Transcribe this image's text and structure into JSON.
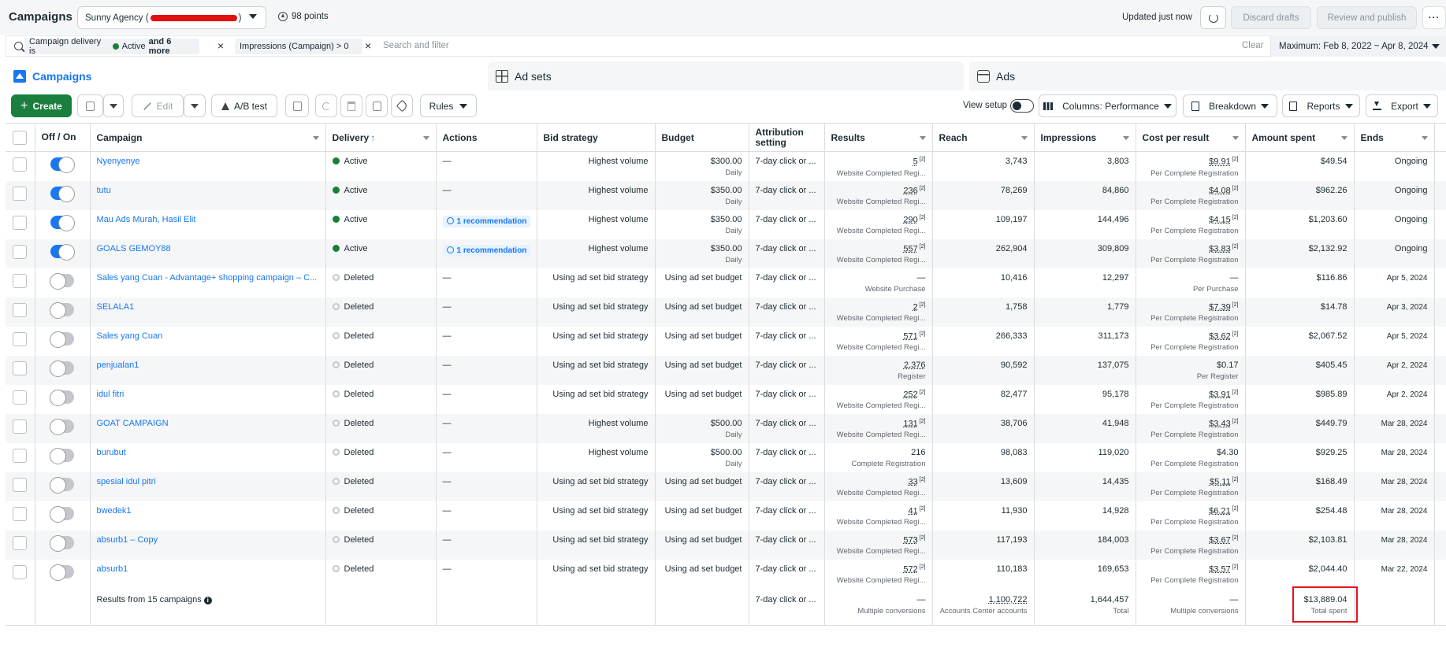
{
  "header": {
    "title": "Campaigns",
    "account_prefix": "Sunny Agency (",
    "account_suffix": ")",
    "points": "98 points",
    "updated": "Updated just now",
    "discard_label": "Discard drafts",
    "publish_label": "Review and publish",
    "more_label": "···"
  },
  "filters": {
    "chip1_text": "Campaign delivery is",
    "chip1_value": "Active",
    "chip1_more": "and 6 more",
    "chip2_text": "Impressions (Campaign) > 0",
    "placeholder": "Search and filter",
    "clear_label": "Clear",
    "date_range": "Maximum: Feb 8, 2022 ~ Apr 8, 2024"
  },
  "tabs": [
    {
      "label": "Campaigns"
    },
    {
      "label": "Ad sets"
    },
    {
      "label": "Ads"
    }
  ],
  "toolbar": {
    "create_label": "Create",
    "edit_label": "Edit",
    "abtest_label": "A/B test",
    "rules_label": "Rules",
    "view_setup_label": "View setup",
    "columns_label": "Columns: Performance",
    "breakdown_label": "Breakdown",
    "reports_label": "Reports",
    "export_label": "Export"
  },
  "columns": {
    "offon": "Off / On",
    "campaign": "Campaign",
    "delivery": "Delivery",
    "actions": "Actions",
    "bid": "Bid strategy",
    "budget": "Budget",
    "attribution": "Attribution setting",
    "results": "Results",
    "reach": "Reach",
    "impressions": "Impressions",
    "cpr": "Cost per result",
    "spent": "Amount spent",
    "ends": "Ends"
  },
  "rows": [
    {
      "on": true,
      "name": "Nyenyenye",
      "delivery": "Active",
      "status": "active",
      "action": "—",
      "bid": "Highest volume",
      "budget": "$300.00",
      "budget_sub": "Daily",
      "attribution": "7-day click or ...",
      "results": "5",
      "results_fn": true,
      "results_sub": "Website Completed Regi...",
      "reach": "3,743",
      "impressions": "3,803",
      "cpr": "$9.91",
      "cpr_fn": true,
      "cpr_sub": "Per Complete Registration",
      "spent": "$49.54",
      "ends": "Ongoing"
    },
    {
      "on": true,
      "name": "tutu",
      "delivery": "Active",
      "status": "active",
      "action": "—",
      "bid": "Highest volume",
      "budget": "$350.00",
      "budget_sub": "Daily",
      "attribution": "7-day click or ...",
      "results": "236",
      "results_fn": true,
      "results_sub": "Website Completed Regi...",
      "reach": "78,269",
      "impressions": "84,860",
      "cpr": "$4.08",
      "cpr_fn": true,
      "cpr_sub": "Per Complete Registration",
      "spent": "$962.26",
      "ends": "Ongoing"
    },
    {
      "on": true,
      "name": "Mau Ads Murah, Hasil Elit",
      "delivery": "Active",
      "status": "active",
      "action": "1 recommendation",
      "bid": "Highest volume",
      "budget": "$350.00",
      "budget_sub": "Daily",
      "attribution": "7-day click or ...",
      "results": "290",
      "results_fn": true,
      "results_sub": "Website Completed Regi...",
      "reach": "109,197",
      "impressions": "144,496",
      "cpr": "$4.15",
      "cpr_fn": true,
      "cpr_sub": "Per Complete Registration",
      "spent": "$1,203.60",
      "ends": "Ongoing"
    },
    {
      "on": true,
      "name": "GOALS GEMOY88",
      "delivery": "Active",
      "status": "active",
      "action": "1 recommendation",
      "bid": "Highest volume",
      "budget": "$350.00",
      "budget_sub": "Daily",
      "attribution": "7-day click or ...",
      "results": "557",
      "results_fn": true,
      "results_sub": "Website Completed Regi...",
      "reach": "262,904",
      "impressions": "309,809",
      "cpr": "$3.83",
      "cpr_fn": true,
      "cpr_sub": "Per Complete Registration",
      "spent": "$2,132.92",
      "ends": "Ongoing"
    },
    {
      "on": false,
      "name": "Sales yang Cuan - Advantage+ shopping campaign – C...",
      "delivery": "Deleted",
      "status": "deleted",
      "action": "—",
      "bid": "Using ad set bid strategy",
      "budget": "Using ad set budget",
      "budget_sub": "",
      "attribution": "7-day click or ...",
      "results": "—",
      "results_fn": false,
      "results_sub": "Website Purchase",
      "reach": "10,416",
      "impressions": "12,297",
      "cpr": "—",
      "cpr_fn": false,
      "cpr_sub": "Per Purchase",
      "spent": "$116.86",
      "ends": "Apr 5, 2024"
    },
    {
      "on": false,
      "name": "SELALA1",
      "delivery": "Deleted",
      "status": "deleted",
      "action": "—",
      "bid": "Using ad set bid strategy",
      "budget": "Using ad set budget",
      "budget_sub": "",
      "attribution": "7-day click or ...",
      "results": "2",
      "results_fn": true,
      "results_sub": "Website Completed Regi...",
      "reach": "1,758",
      "impressions": "1,779",
      "cpr": "$7.39",
      "cpr_fn": true,
      "cpr_sub": "Per Complete Registration",
      "spent": "$14.78",
      "ends": "Apr 3, 2024"
    },
    {
      "on": false,
      "name": "Sales yang Cuan",
      "delivery": "Deleted",
      "status": "deleted",
      "action": "—",
      "bid": "Using ad set bid strategy",
      "budget": "Using ad set budget",
      "budget_sub": "",
      "attribution": "7-day click or ...",
      "results": "571",
      "results_fn": true,
      "results_sub": "Website Completed Regi...",
      "reach": "266,333",
      "impressions": "311,173",
      "cpr": "$3.62",
      "cpr_fn": true,
      "cpr_sub": "Per Complete Registration",
      "spent": "$2,067.52",
      "ends": "Apr 5, 2024"
    },
    {
      "on": false,
      "name": "penjualan1",
      "delivery": "Deleted",
      "status": "deleted",
      "action": "—",
      "bid": "Using ad set bid strategy",
      "budget": "Using ad set budget",
      "budget_sub": "",
      "attribution": "7-day click or ...",
      "results": "2,376",
      "results_fn": false,
      "results_sub": "Register",
      "reach": "90,592",
      "impressions": "137,075",
      "cpr": "$0.17",
      "cpr_fn": false,
      "cpr_sub": "Per Register",
      "spent": "$405.45",
      "ends": "Apr 2, 2024"
    },
    {
      "on": false,
      "name": "idul fitri",
      "delivery": "Deleted",
      "status": "deleted",
      "action": "—",
      "bid": "Using ad set bid strategy",
      "budget": "Using ad set budget",
      "budget_sub": "",
      "attribution": "7-day click or ...",
      "results": "252",
      "results_fn": true,
      "results_sub": "Website Completed Regi...",
      "reach": "82,477",
      "impressions": "95,178",
      "cpr": "$3.91",
      "cpr_fn": true,
      "cpr_sub": "Per Complete Registration",
      "spent": "$985.89",
      "ends": "Apr 2, 2024"
    },
    {
      "on": false,
      "name": "GOAT CAMPAIGN",
      "delivery": "Deleted",
      "status": "deleted",
      "action": "—",
      "bid": "Highest volume",
      "budget": "$500.00",
      "budget_sub": "Daily",
      "attribution": "7-day click or ...",
      "results": "131",
      "results_fn": true,
      "results_sub": "Website Completed Regi...",
      "reach": "38,706",
      "impressions": "41,948",
      "cpr": "$3.43",
      "cpr_fn": true,
      "cpr_sub": "Per Complete Registration",
      "spent": "$449.79",
      "ends": "Mar 28, 2024"
    },
    {
      "on": false,
      "name": "burubut",
      "delivery": "Deleted",
      "status": "deleted",
      "action": "—",
      "bid": "Highest volume",
      "budget": "$500.00",
      "budget_sub": "Daily",
      "attribution": "7-day click or ...",
      "results": "216",
      "results_fn": false,
      "results_sub": "Complete Registration",
      "reach": "98,083",
      "impressions": "119,020",
      "cpr": "$4.30",
      "cpr_fn": false,
      "cpr_sub": "Per Complete Registration",
      "spent": "$929.25",
      "ends": "Mar 28, 2024"
    },
    {
      "on": false,
      "name": "spesial idul pitri",
      "delivery": "Deleted",
      "status": "deleted",
      "action": "—",
      "bid": "Using ad set bid strategy",
      "budget": "Using ad set budget",
      "budget_sub": "",
      "attribution": "7-day click or ...",
      "results": "33",
      "results_fn": true,
      "results_sub": "Website Completed Regi...",
      "reach": "13,609",
      "impressions": "14,435",
      "cpr": "$5.11",
      "cpr_fn": true,
      "cpr_sub": "Per Complete Registration",
      "spent": "$168.49",
      "ends": "Mar 28, 2024"
    },
    {
      "on": false,
      "name": "bwedek1",
      "delivery": "Deleted",
      "status": "deleted",
      "action": "—",
      "bid": "Using ad set bid strategy",
      "budget": "Using ad set budget",
      "budget_sub": "",
      "attribution": "7-day click or ...",
      "results": "41",
      "results_fn": true,
      "results_sub": "Website Completed Regi...",
      "reach": "11,930",
      "impressions": "14,928",
      "cpr": "$6.21",
      "cpr_fn": true,
      "cpr_sub": "Per Complete Registration",
      "spent": "$254.48",
      "ends": "Mar 28, 2024"
    },
    {
      "on": false,
      "name": "absurb1 – Copy",
      "delivery": "Deleted",
      "status": "deleted",
      "action": "—",
      "bid": "Using ad set bid strategy",
      "budget": "Using ad set budget",
      "budget_sub": "",
      "attribution": "7-day click or ...",
      "results": "573",
      "results_fn": true,
      "results_sub": "Website Completed Regi...",
      "reach": "117,193",
      "impressions": "184,003",
      "cpr": "$3.67",
      "cpr_fn": true,
      "cpr_sub": "Per Complete Registration",
      "spent": "$2,103.81",
      "ends": "Mar 28, 2024"
    },
    {
      "on": false,
      "name": "absurb1",
      "delivery": "Deleted",
      "status": "deleted",
      "action": "—",
      "bid": "Using ad set bid strategy",
      "budget": "Using ad set budget",
      "budget_sub": "",
      "attribution": "7-day click or ...",
      "results": "572",
      "results_fn": true,
      "results_sub": "Website Completed Regi...",
      "reach": "110,183",
      "impressions": "169,653",
      "cpr": "$3.57",
      "cpr_fn": true,
      "cpr_sub": "Per Complete Registration",
      "spent": "$2,044.40",
      "ends": "Mar 22, 2024"
    }
  ],
  "footer": {
    "label": "Results from 15 campaigns",
    "attribution": "7-day click or ...",
    "results": "—",
    "results_sub": "Multiple conversions",
    "reach": "1,100,722",
    "reach_sub": "Accounts Center accounts",
    "impressions": "1,644,457",
    "impressions_sub": "Total",
    "cpr": "—",
    "cpr_sub": "Multiple conversions",
    "spent": "$13,889.04",
    "spent_sub": "Total spent"
  },
  "colors": {
    "accent": "#1877f2",
    "create": "#1a7f3e",
    "active_status": "#1a7f37",
    "highlight": "#e4141b"
  }
}
